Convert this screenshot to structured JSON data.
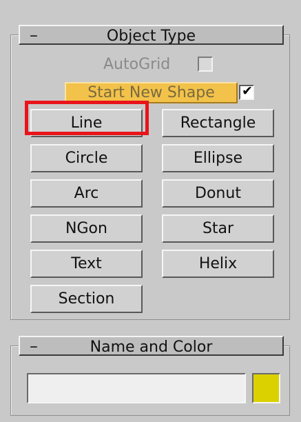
{
  "object_type": {
    "collapse_symbol": "–",
    "title": "Object Type",
    "autogrid_label": "AutoGrid",
    "autogrid_checked": false,
    "start_new_shape_label": "Start New Shape",
    "start_new_shape_checked": true,
    "buttons": [
      "Line",
      "Rectangle",
      "Circle",
      "Ellipse",
      "Arc",
      "Donut",
      "NGon",
      "Star",
      "Text",
      "Helix",
      "Section"
    ],
    "selected_button": "Line"
  },
  "name_and_color": {
    "collapse_symbol": "–",
    "title": "Name and Color",
    "name_value": "",
    "swatch_color": "#dcd100"
  },
  "colors": {
    "highlight": "#e8141a",
    "start_button": "#f2c24a"
  }
}
